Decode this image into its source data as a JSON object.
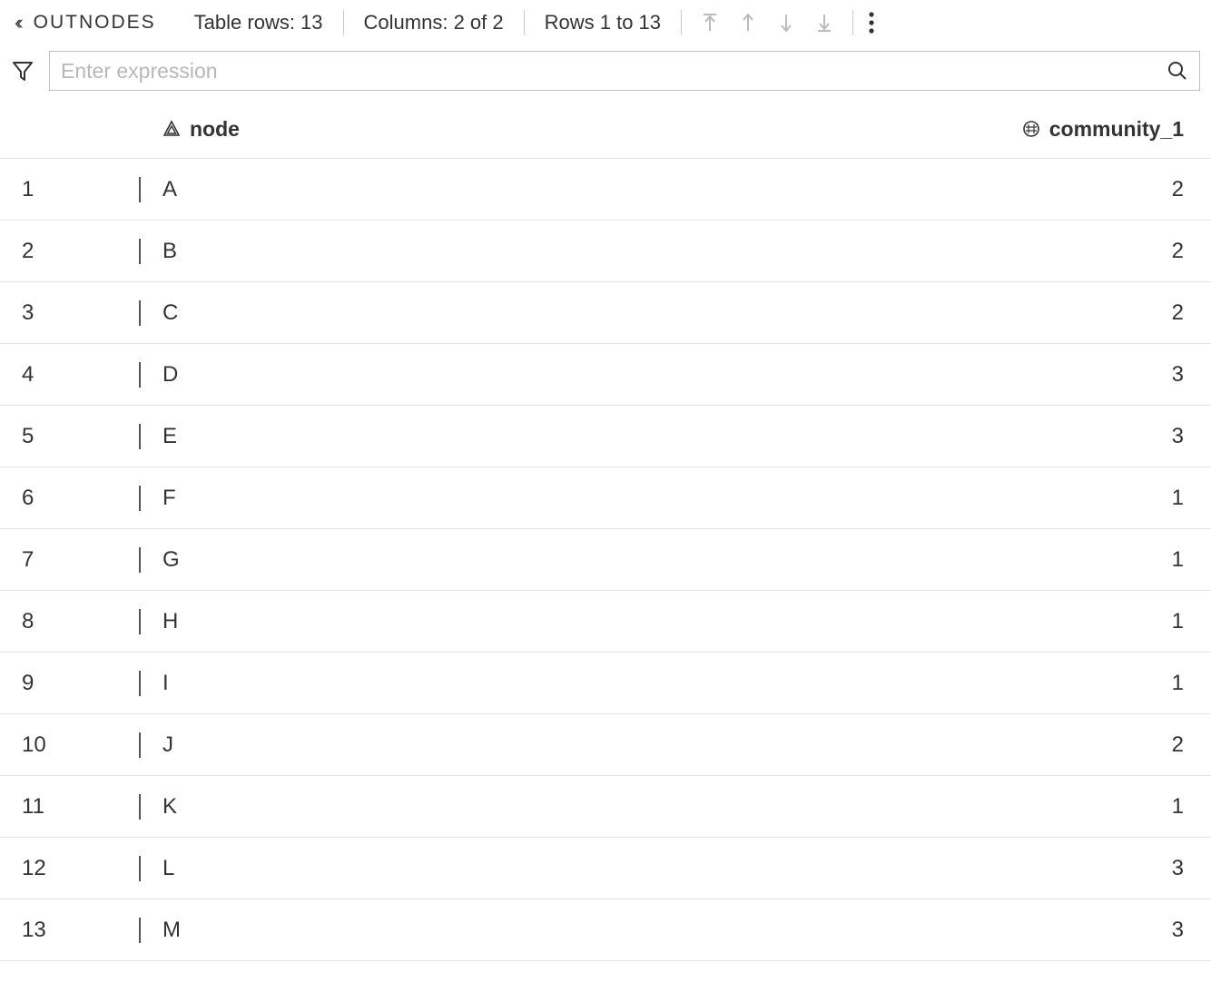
{
  "toolbar": {
    "title": "OUTNODES",
    "table_rows": "Table rows: 13",
    "columns": "Columns: 2 of 2",
    "rows_range": "Rows 1 to 13"
  },
  "filter": {
    "placeholder": "Enter expression",
    "value": ""
  },
  "columns": {
    "node": "node",
    "community": "community_1"
  },
  "rows": [
    {
      "n": "1",
      "node": "A",
      "community": "2"
    },
    {
      "n": "2",
      "node": "B",
      "community": "2"
    },
    {
      "n": "3",
      "node": "C",
      "community": "2"
    },
    {
      "n": "4",
      "node": "D",
      "community": "3"
    },
    {
      "n": "5",
      "node": "E",
      "community": "3"
    },
    {
      "n": "6",
      "node": "F",
      "community": "1"
    },
    {
      "n": "7",
      "node": "G",
      "community": "1"
    },
    {
      "n": "8",
      "node": "H",
      "community": "1"
    },
    {
      "n": "9",
      "node": "I",
      "community": "1"
    },
    {
      "n": "10",
      "node": "J",
      "community": "2"
    },
    {
      "n": "11",
      "node": "K",
      "community": "1"
    },
    {
      "n": "12",
      "node": "L",
      "community": "3"
    },
    {
      "n": "13",
      "node": "M",
      "community": "3"
    }
  ]
}
